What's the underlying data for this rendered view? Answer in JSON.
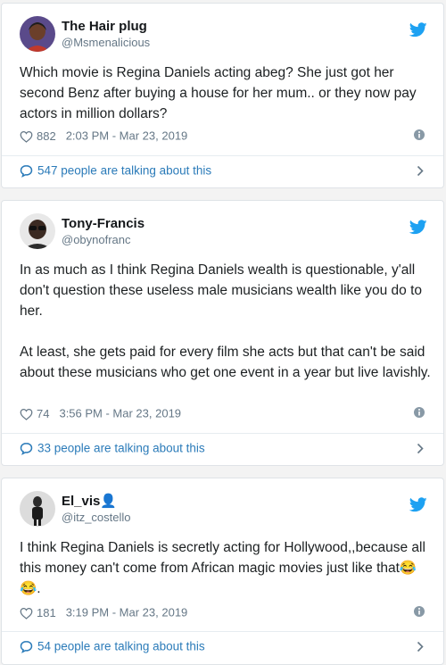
{
  "tweets": [
    {
      "name": "The Hair plug",
      "handle": "@Msmenalicious",
      "text": "Which movie is Regina Daniels acting abeg? She just got her second Benz after buying a house for her mum.. or they now pay actors in million dollars?",
      "likes": "882",
      "datetime": "2:03 PM - Mar 23, 2019",
      "talking": "547 people are talking about this"
    },
    {
      "name": "Tony-Francis",
      "handle": "@obynofranc",
      "text": "In as much as I think Regina Daniels wealth is questionable, y'all don't question these useless male musicians wealth like you do to her.\n\nAt least, she gets paid for every film she acts but that can't be said about these musicians who get one event in a year but live lavishly.",
      "likes": "74",
      "datetime": "3:56 PM - Mar 23, 2019",
      "talking": "33 people are talking about this"
    },
    {
      "name": "El_vis👤",
      "handle": "@itz_costello",
      "text": "I think Regina Daniels is secretly acting for Hollywood,,because all this money can't come from African magic movies just like that😂😂.",
      "likes": "181",
      "datetime": "3:19 PM - Mar 23, 2019",
      "talking": "54 people are talking about this"
    }
  ],
  "colors": {
    "twitter_blue": "#1da1f2",
    "link_blue": "#2b7bb9",
    "meta_gray": "#657786"
  },
  "icons": [
    "twitter-bird-icon",
    "heart-icon",
    "info-icon",
    "speech-bubble-icon",
    "chevron-right-icon"
  ]
}
